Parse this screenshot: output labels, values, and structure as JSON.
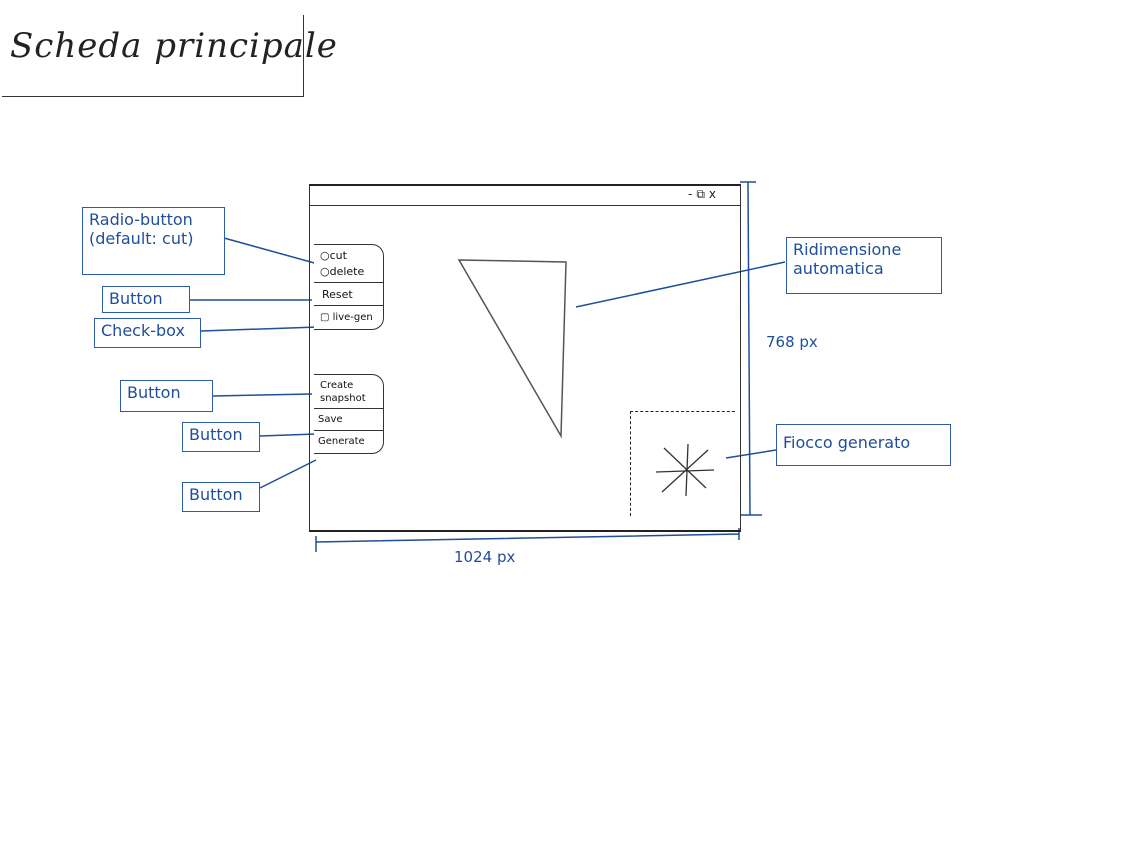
{
  "page_title": "Scheda principale",
  "window": {
    "controls": [
      "-",
      "⧉",
      "x"
    ]
  },
  "tool_panel": {
    "radio_options": [
      "cut",
      "delete"
    ],
    "reset_label": "Reset",
    "checkbox_label": "live-gen"
  },
  "action_panel": {
    "create_snapshot_line1": "Create",
    "create_snapshot_line2": "snapshot",
    "save_label": "Save",
    "generate_label": "Generate"
  },
  "annotations": {
    "radio_line1": "Radio-button",
    "radio_line2": "(default: cut)",
    "reset_button": "Button",
    "checkbox": "Check-box",
    "create_button": "Button",
    "save_button": "Button",
    "generate_button": "Button",
    "resize_line1": "Ridimensione",
    "resize_line2": "automatica",
    "generated": "Fiocco generato"
  },
  "dimensions": {
    "height_label": "768 px",
    "width_label": "1024 px"
  },
  "colors": {
    "ink": "#222222",
    "annotation_blue": "#1f4e9a"
  }
}
